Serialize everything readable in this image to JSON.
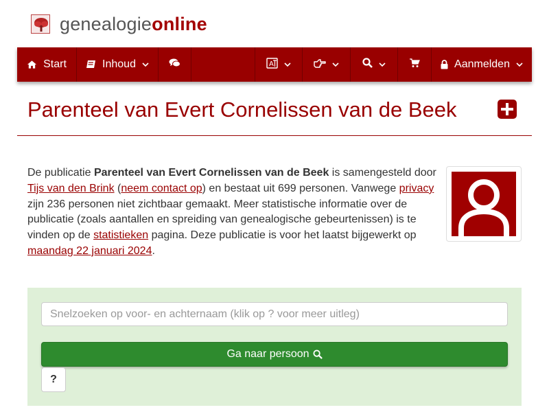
{
  "logo": {
    "part1": "genealogie",
    "part2": "online"
  },
  "nav": {
    "start": "Start",
    "inhoud": "Inhoud",
    "login": "Aanmelden",
    "icons": [
      "home-icon",
      "book-icon",
      "comments-icon",
      "language-icon",
      "hand-point-right-icon",
      "search-icon",
      "shopping-cart-icon",
      "lock-icon"
    ]
  },
  "page": {
    "title": "Parenteel van Evert Cornelissen van de Beek"
  },
  "intro": {
    "t1": "De publicatie ",
    "pub_title": "Parenteel van Evert Cornelissen van de Beek",
    "t2": " is samengesteld door ",
    "author": "Tijs van den Brink",
    "t3": " (",
    "contact": "neem contact op",
    "t4": ") en bestaat uit 699 personen. Vanwege ",
    "privacy": "privacy",
    "t5": " zijn 236 personen niet zichtbaar gemaakt. Meer statistische informatie over de publicatie (zoals aantallen en spreiding van genealogische gebeurtenissen) is te vinden op de ",
    "stats": "statistieken",
    "t6": " pagina. Deze publicatie is voor het laatst bijgewerkt op ",
    "date": "maandag 22 januari 2024",
    "t7": "."
  },
  "search": {
    "placeholder": "Snelzoeken op voor- en achternaam (klik op ? voor meer uitleg)",
    "button": "Ga naar persoon",
    "help": "?"
  },
  "colors": {
    "brand": "#990000",
    "panel": "#dff0d8",
    "button": "#2e8b2e"
  }
}
